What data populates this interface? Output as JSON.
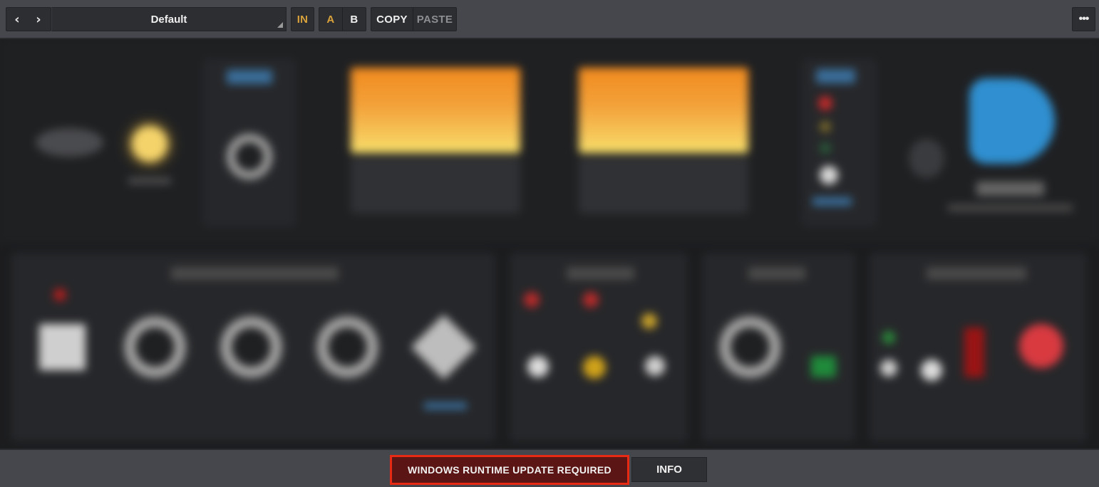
{
  "toolbar": {
    "back_icon": "chevron-left-icon",
    "forward_icon": "chevron-right-icon",
    "preset_name": "Default",
    "in_label": "IN",
    "a_label": "A",
    "b_label": "B",
    "copy_label": "COPY",
    "paste_label": "PASTE",
    "more_label": "•••"
  },
  "footer": {
    "warning_label": "WINDOWS RUNTIME UPDATE REQUIRED",
    "info_label": "INFO"
  },
  "colors": {
    "toolbar_bg": "#45474c",
    "accent_orange": "#d9a23a",
    "meter_orange": "#f08a1e",
    "warning_border": "#e82a14",
    "warning_bg": "#5b1515",
    "disabled_text": "#8d8e91"
  }
}
